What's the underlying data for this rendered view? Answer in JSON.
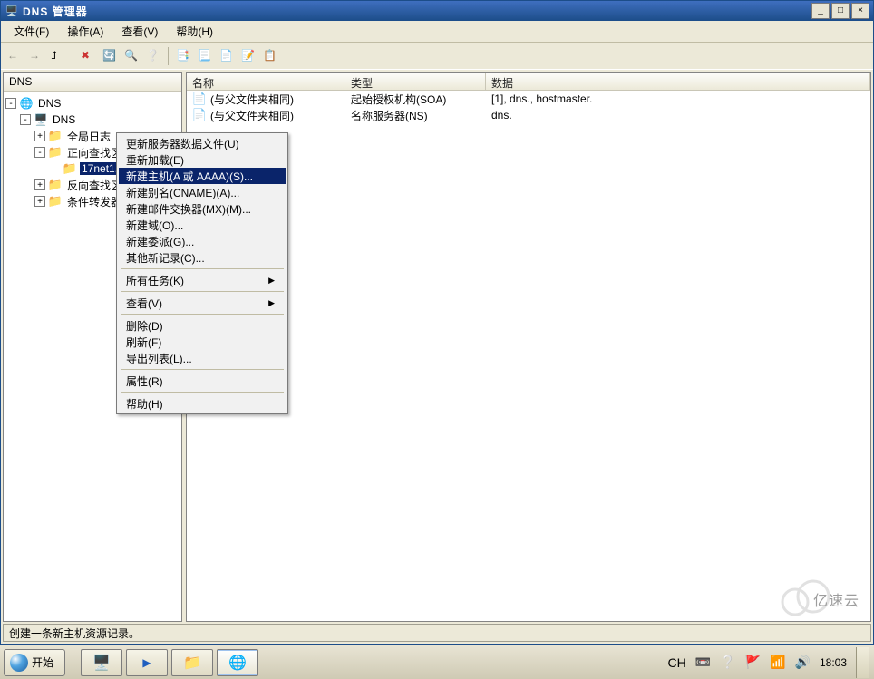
{
  "window": {
    "title": "DNS 管理器",
    "controls": {
      "min": "_",
      "max": "□",
      "close": "×"
    }
  },
  "menubar": [
    {
      "label": "文件(F)"
    },
    {
      "label": "操作(A)"
    },
    {
      "label": "查看(V)"
    },
    {
      "label": "帮助(H)"
    }
  ],
  "toolbar": {
    "back": "←",
    "forward": "→",
    "up": "⮥",
    "delete": "✖",
    "refresh": "🔄",
    "props": "🔍",
    "help": "❔",
    "group": [
      "📑",
      "📃",
      "📄",
      "📝",
      "📋"
    ]
  },
  "breadcrumb": "DNS",
  "tree": {
    "root_label": "DNS",
    "server": "DNS",
    "items": [
      {
        "label": "全局日志",
        "expand": "+",
        "indent": 2,
        "icon": "fld"
      },
      {
        "label": "正向查找区域",
        "expand": "-",
        "indent": 2,
        "icon": "fld"
      },
      {
        "label": "17net1.",
        "expand": "",
        "indent": 3,
        "icon": "fld",
        "selected": true
      },
      {
        "label": "反向查找区",
        "expand": "+",
        "indent": 2,
        "icon": "fld"
      },
      {
        "label": "条件转发器",
        "expand": "+",
        "indent": 2,
        "icon": "fld"
      }
    ]
  },
  "listview": {
    "headers": {
      "name": "名称",
      "type": "类型",
      "data": "数据"
    },
    "rows": [
      {
        "name": "(与父文件夹相同)",
        "type": "起始授权机构(SOA)",
        "data": "[1], dns., hostmaster."
      },
      {
        "name": "(与父文件夹相同)",
        "type": "名称服务器(NS)",
        "data": "dns."
      }
    ]
  },
  "contextmenu": [
    {
      "label": "更新服务器数据文件(U)"
    },
    {
      "label": "重新加载(E)"
    },
    {
      "label": "新建主机(A 或 AAAA)(S)...",
      "selected": true
    },
    {
      "label": "新建别名(CNAME)(A)..."
    },
    {
      "label": "新建邮件交换器(MX)(M)..."
    },
    {
      "label": "新建域(O)..."
    },
    {
      "label": "新建委派(G)..."
    },
    {
      "label": "其他新记录(C)..."
    },
    {
      "sep": true
    },
    {
      "label": "所有任务(K)",
      "submenu": true
    },
    {
      "sep": true
    },
    {
      "label": "查看(V)",
      "submenu": true
    },
    {
      "sep": true
    },
    {
      "label": "删除(D)"
    },
    {
      "label": "刷新(F)"
    },
    {
      "label": "导出列表(L)..."
    },
    {
      "sep": true
    },
    {
      "label": "属性(R)"
    },
    {
      "sep": true
    },
    {
      "label": "帮助(H)"
    }
  ],
  "statusbar": "创建一条新主机资源记录。",
  "taskbar": {
    "start": "开始",
    "lang": "CH",
    "time": "18:03",
    "date": ""
  },
  "watermark": "亿速云"
}
